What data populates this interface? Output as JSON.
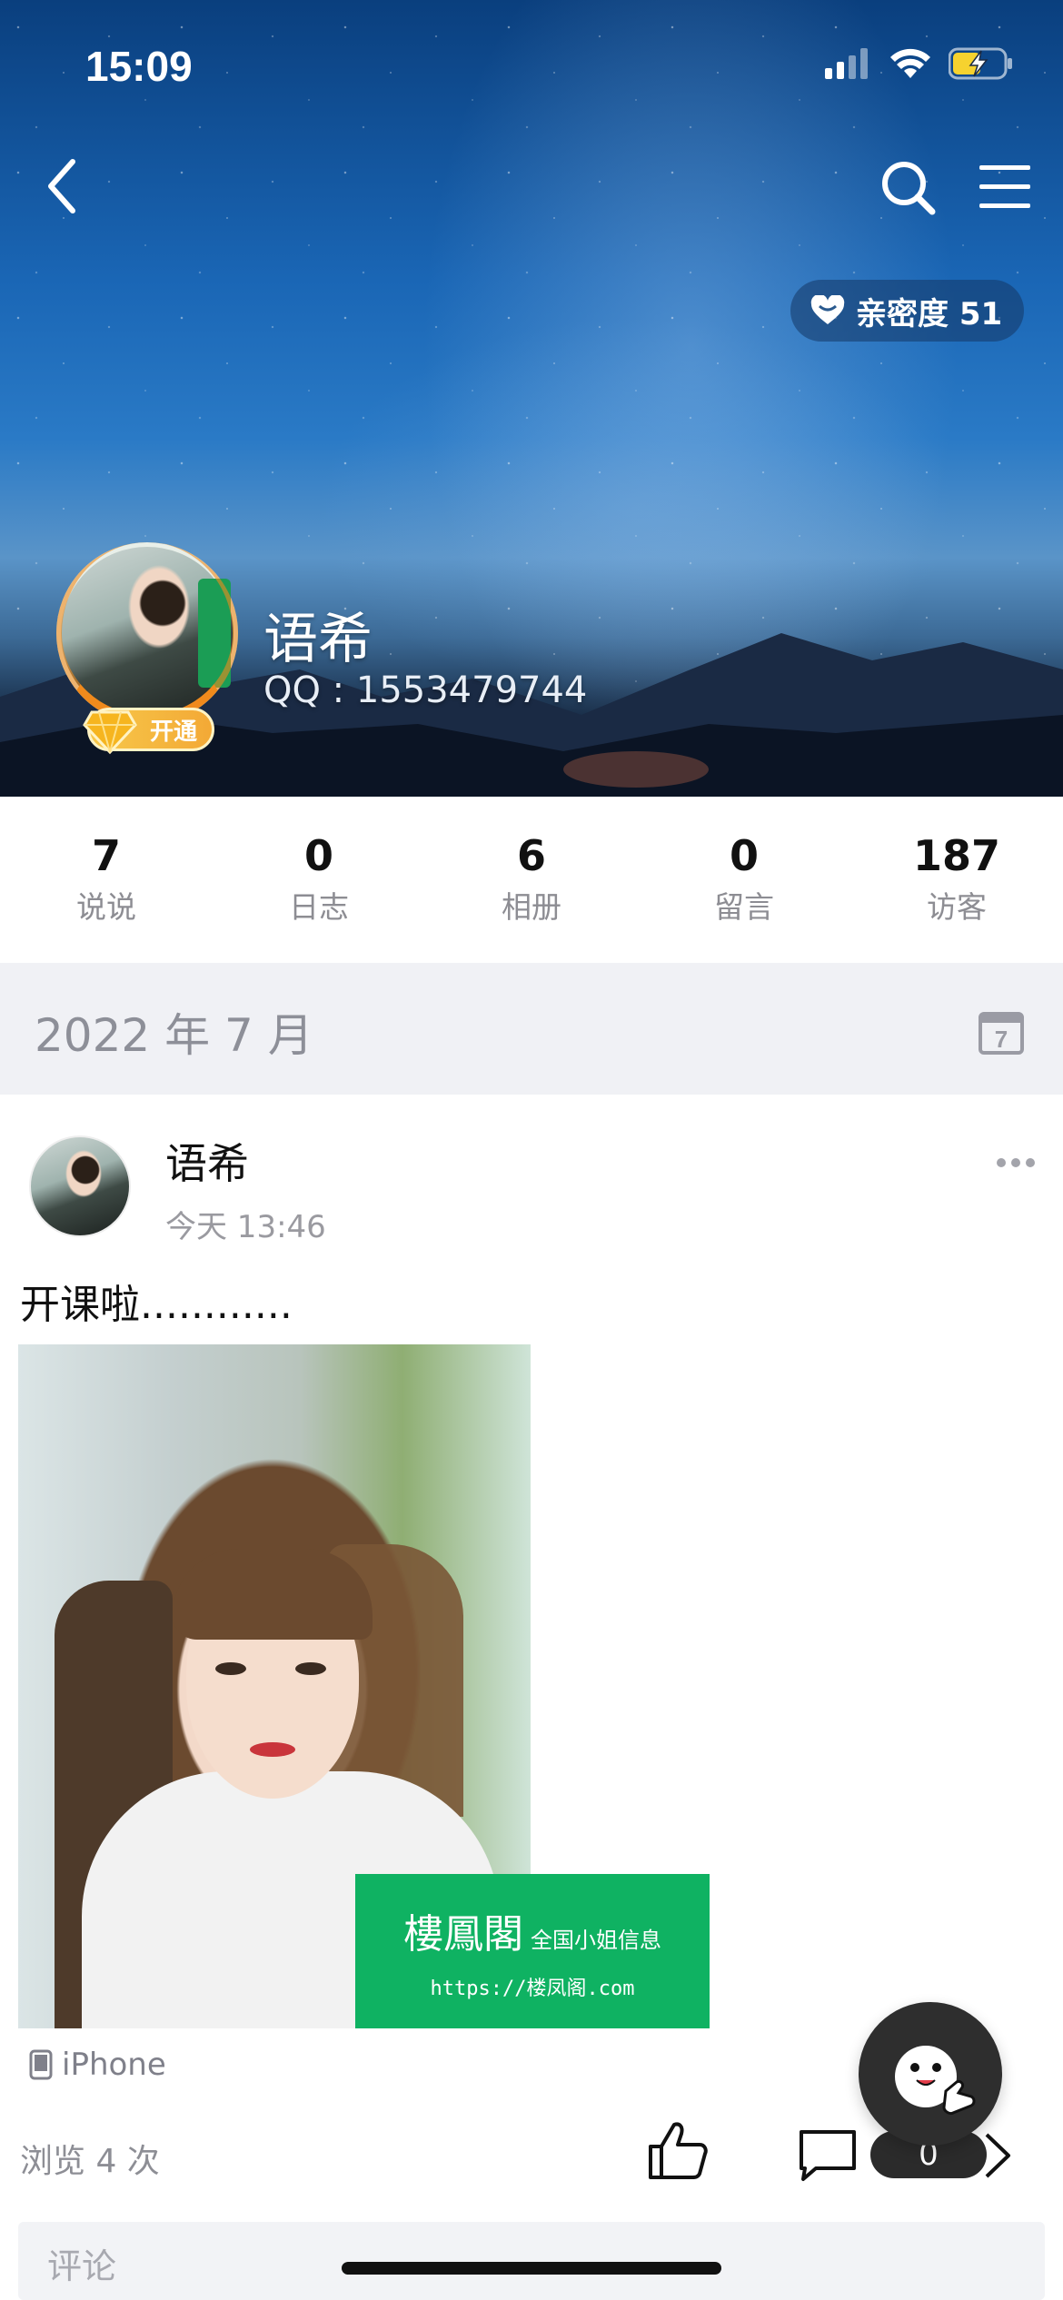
{
  "status_bar": {
    "time": "15:09"
  },
  "header": {
    "intimacy_label": "亲密度 51",
    "name": "语希",
    "qq": "QQ : 1553479744",
    "vip_badge": "开通"
  },
  "stats": [
    {
      "value": "7",
      "label": "说说"
    },
    {
      "value": "0",
      "label": "日志"
    },
    {
      "value": "6",
      "label": "相册"
    },
    {
      "value": "0",
      "label": "留言"
    },
    {
      "value": "187",
      "label": "访客"
    }
  ],
  "date_band": {
    "label": "2022 年 7 月",
    "calendar_day": "7"
  },
  "post": {
    "author": "语希",
    "time": "今天 13:46",
    "text": "开课啦............",
    "watermark": {
      "title": "樓鳳閣",
      "subtitle": "全国小姐信息",
      "url": "https://楼凤阁.com"
    },
    "device": "iPhone",
    "views": "浏览 4 次",
    "comment_count": "0"
  },
  "comment_placeholder": "评论",
  "icons": {
    "back": "chevron-left-icon",
    "search": "search-icon",
    "menu": "menu-icon",
    "heart": "heart-icon",
    "calendar": "calendar-icon",
    "more": "more-icon",
    "phone": "phone-icon",
    "like": "thumbs-up-icon",
    "comment": "comment-icon",
    "share": "chevron-right-icon"
  }
}
